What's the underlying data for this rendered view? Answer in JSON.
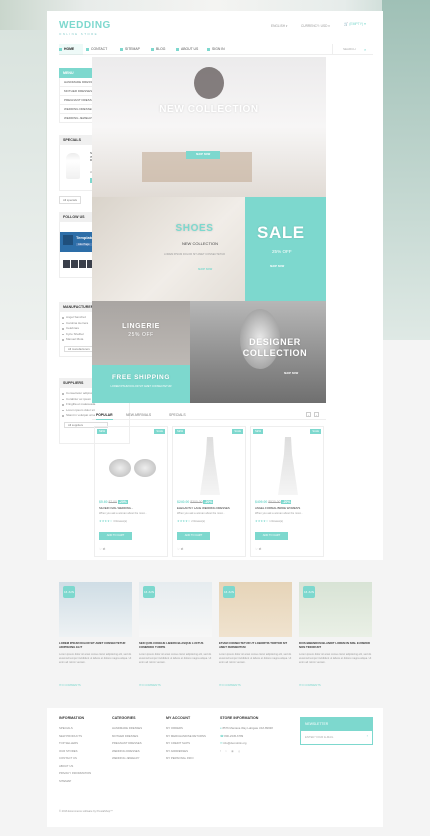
{
  "header": {
    "logo_main": "WEDDING",
    "logo_sub": "ONLINE STORE",
    "language": "ENGLISH ▾",
    "currency": "CURRENCY: USD ▾",
    "cart": "(EMPTY) ▾"
  },
  "nav": {
    "items": [
      "HOME",
      "CONTACT",
      "SITEMAP",
      "BLOG",
      "ABOUT US",
      "SIGN IN"
    ],
    "search_placeholder": "SEARCH"
  },
  "sidebar": {
    "menu_title": "MENU",
    "menu_items": [
      "HANDMADE DRESSES",
      "MOTHER DRESSES",
      "PREGNANT DRESSES",
      "WEDDING DRESSES",
      "WEDDING JEWELRY"
    ],
    "specials_title": "SPECIALS",
    "special": {
      "name": "STRAPLESS BALL GOWN IN LACE WEDDING DRESS",
      "desc": "When you ask a woman",
      "disc": "-20%",
      "price": "$24.00"
    },
    "all_specials": "All specials",
    "follow_title": "FOLLOW US",
    "fb_name": "TemplateMonster",
    "fb_like": "Like Page",
    "manufacturers_title": "MANUFACTURERS",
    "manufacturers": [
      "Angel Sanchez",
      "Carolina Herrera",
      "Celebrare",
      "Kyrie Shelbel",
      "Manuel Mota"
    ],
    "all_manufacturers": "All manufacturers",
    "suppliers_title": "SUPPLIERS",
    "suppliers": [
      "Consectetur adipiscing elit",
      "Curabitur ac ipsum pellentesque",
      "Fringilla et malesuada",
      "Lorem ipsum dolor sit",
      "Sitant in volutpat urna"
    ],
    "all_suppliers": "All suppliers"
  },
  "banners": {
    "new_collection": "NEW COLLECTION",
    "shop_now": "SHOP NOW",
    "shoes_title": "SHOES",
    "shoes_sub": "NEW COLLECTION",
    "shoes_text": "LOREM IPSUM DOLOR SIT AMET CONSECTETUR",
    "sale_title": "SALE",
    "sale_sub": "25% OFF",
    "lingerie_title": "LINGERIE",
    "lingerie_sub": "25% OFF",
    "designer_title": "DESIGNER COLLECTION",
    "freeship_title": "FREE SHIPPING",
    "freeship_text": "LOREM IPSUM DOLOR SIT AMET CONSECTETUR"
  },
  "products": {
    "tabs": [
      "POPULAR",
      "NEW ARRIVALS",
      "SPECIALS"
    ],
    "new_tag": "NEW",
    "sale_tag": "SALE",
    "add_to_cart": "ADD TO CART",
    "items": [
      {
        "price": "$5.60",
        "old": "$7.00",
        "disc": "-20%",
        "name": "SILVER OVAL WEDDING...",
        "desc": "When you ask a woman about the most...",
        "reviews": "3 Review(s)"
      },
      {
        "price": "$240.00",
        "old": "$300.00",
        "disc": "-20%",
        "name": "ELEGANTLY LACE WEDDING DRESSES",
        "desc": "When you ask a woman about the most...",
        "reviews": "2 Review(s)"
      },
      {
        "price": "$409.00",
        "old": "$520.00",
        "disc": "-20%",
        "name": "ANGEL FORMAL BRIDE WOMEN'S",
        "desc": "When you ask a woman about the most...",
        "reviews": "1 Review(s)"
      }
    ]
  },
  "blog": {
    "comments": "0 COMMENTS",
    "posts": [
      {
        "date": "16 JUN",
        "title": "LOREM IPSUM DOLOR SIT AMET CONSECTETUR ADIPISCING ELIT",
        "text": "Lorem ipsum dolor sit amet conse ctetur adipisicing elit, sed do eiusmod tempor incididunt ut labore et dolore magna aliqua. Ut enim ad minim veniam."
      },
      {
        "date": "16 JUN",
        "title": "SED QUIS CONGUE LIBERO BLASQUE LUCTUS COMMODO TURPIS",
        "text": "Lorem ipsum dolor sit amet conse ctetur adipisicing elit, sed do eiusmod tempor incididunt ut labore et dolore magna aliqua. Ut enim ad minim veniam."
      },
      {
        "date": "16 JUN",
        "title": "ETIAM CONSECTETUR UT LOBORTIS TORTOR SIT AMET FERMENTUM",
        "text": "Lorem ipsum dolor sit amet conse ctetur adipisicing elit, sed do eiusmod tempor incididunt ut labore et dolore magna aliqua. Ut enim ad minim veniam."
      },
      {
        "date": "16 JUN",
        "title": "DUIS BIBENDUM BLANDIT LOREM IN NISL EUISMOD NON TINCIDUNT",
        "text": "Lorem ipsum dolor sit amet conse ctetur adipisicing elit, sed do eiusmod tempor incididunt ut labore et dolore magna aliqua. Ut enim ad minim veniam."
      }
    ]
  },
  "footer": {
    "info_title": "INFORMATION",
    "info_links": [
      "SPECIALS",
      "NEW PRODUCTS",
      "TOP SELLERS",
      "OUR STORES",
      "CONTACT US",
      "ABOUT US",
      "PRIVACY INFORMATION",
      "SITEMAP"
    ],
    "cat_title": "CATEGORIES",
    "cat_links": [
      "HANDMADE DRESSES",
      "MOTHER DRESSES",
      "PREGNANT DRESSES",
      "WEDDING DRESSES",
      "WEDDING JEWELRY"
    ],
    "account_title": "MY ACCOUNT",
    "account_links": [
      "MY ORDERS",
      "MY MERCHANDISE RETURNS",
      "MY CREDIT SLIPS",
      "MY ADDRESSES",
      "MY PERSONAL INFO"
    ],
    "store_title": "STORE INFORMATION",
    "store_address": "8576 Mantana Way Labigate UFA 89938",
    "store_phone": "800-2345-6789",
    "store_email": "info@demolink.org",
    "newsletter_title": "NEWSLETTER",
    "newsletter_placeholder": "ENTER YOUR E-MAIL",
    "copyright": "© 2016 Ecommerce software by PrestaShop™"
  }
}
